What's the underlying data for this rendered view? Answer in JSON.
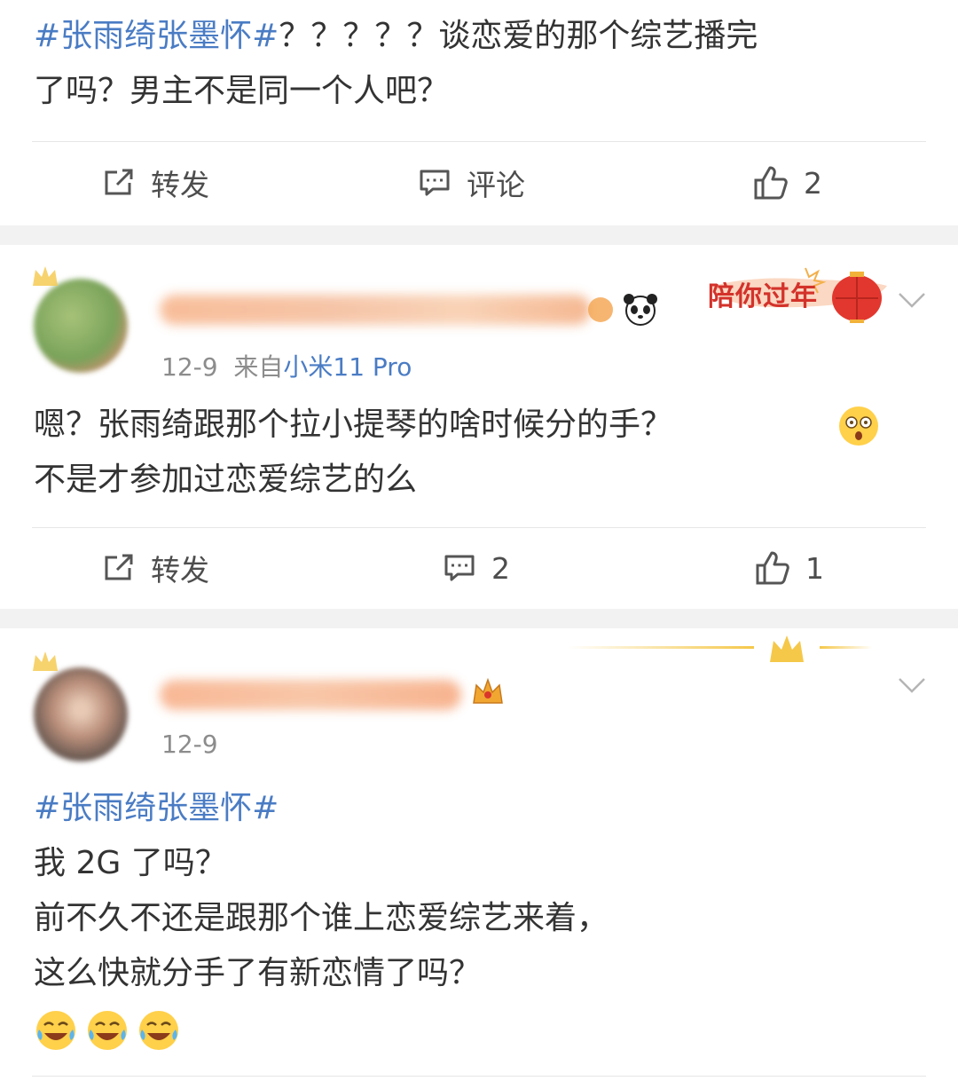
{
  "posts": [
    {
      "topic": "#张雨绮张墨怀#",
      "text_line1_rest": "？？？？？谈恋爱的那个综艺播完",
      "text_line2": "了吗？男主不是同一个人吧？",
      "actions": {
        "repost_label": "转发",
        "comment_label": "评论",
        "like_count": "2"
      }
    },
    {
      "date": "12-9",
      "source_prefix": "来自",
      "source_device": "小米11 Pro",
      "badge_text": "陪你过年",
      "text_line1": "嗯？张雨绮跟那个拉小提琴的啥时候分的手？",
      "text_line2": "不是才参加过恋爱综艺的么",
      "actions": {
        "repost_label": "转发",
        "comment_count": "2",
        "like_count": "1"
      }
    },
    {
      "date": "12-9",
      "topic": "#张雨绮张墨怀#",
      "text_line2": "我 2G 了吗？",
      "text_line3": "前不久不还是跟那个谁上恋爱综艺来着，",
      "text_line4": "这么快就分手了有新恋情了吗？"
    }
  ],
  "colors": {
    "topic_blue": "#4a7cc4",
    "text": "#333333",
    "meta_gray": "#8c8c8c",
    "card_bg": "#ffffff",
    "page_bg": "#f2f2f2"
  },
  "icons": [
    "repost-icon",
    "comment-icon",
    "like-icon",
    "chevron-down-icon",
    "panda-icon",
    "crown-icon",
    "lantern-icon",
    "astonished-emoji",
    "tears-of-joy-emoji"
  ]
}
